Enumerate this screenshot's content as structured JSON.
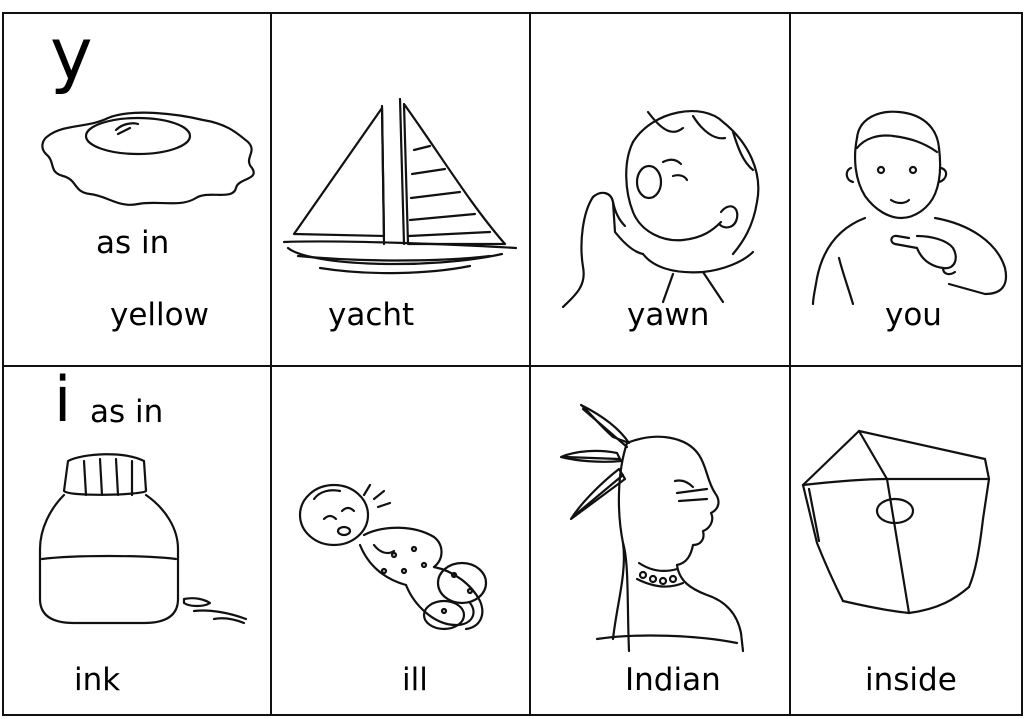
{
  "top_row": {
    "letter": "y",
    "as_in": "as in",
    "cells": [
      {
        "word": "yellow",
        "picture": "egg-icon"
      },
      {
        "word": "yacht",
        "picture": "sailboat-icon"
      },
      {
        "word": "yawn",
        "picture": "yawning-boy-icon"
      },
      {
        "word": "you",
        "picture": "pointing-child-icon"
      }
    ]
  },
  "bottom_row": {
    "letter": "i",
    "as_in": "as in",
    "cells": [
      {
        "word": "ink",
        "picture": "ink-bottle-icon"
      },
      {
        "word": "ill",
        "picture": "sick-baby-icon"
      },
      {
        "word": "Indian",
        "picture": "feathered-man-icon"
      },
      {
        "word": "inside",
        "picture": "open-box-icon"
      }
    ]
  }
}
